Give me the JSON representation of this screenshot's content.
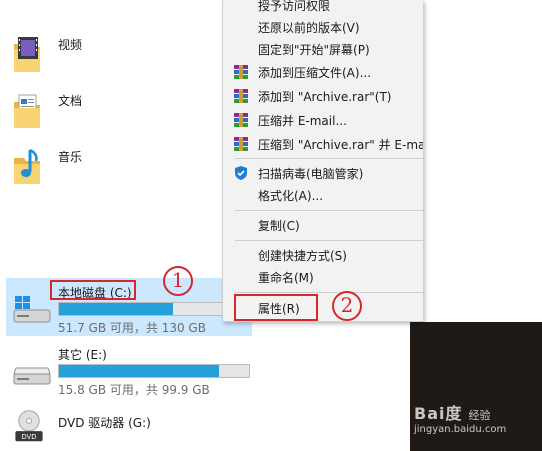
{
  "folders": [
    {
      "label": "视频",
      "icon": "video-folder-icon"
    },
    {
      "label": "文档",
      "icon": "documents-folder-icon"
    },
    {
      "label": "音乐",
      "icon": "music-folder-icon"
    }
  ],
  "drives": [
    {
      "name": "本地磁盘 (C:)",
      "info": "51.7 GB 可用，共 130 GB",
      "used_fraction": 0.6,
      "selected": true,
      "icon": "windows-drive-icon"
    },
    {
      "name": "其它 (E:)",
      "info": "15.8 GB 可用，共 99.9 GB",
      "used_fraction": 0.84,
      "selected": false,
      "icon": "hard-drive-icon"
    },
    {
      "name": "DVD 驱动器 (G:)",
      "icon": "dvd-drive-icon"
    }
  ],
  "context_menu": {
    "items": [
      {
        "label": "授予访问权限",
        "icon": ""
      },
      {
        "label": "还原以前的版本(V)",
        "icon": ""
      },
      {
        "label": "固定到\"开始\"屏幕(P)",
        "icon": ""
      },
      {
        "label": "添加到压缩文件(A)...",
        "icon": "winrar-icon"
      },
      {
        "label": "添加到 \"Archive.rar\"(T)",
        "icon": "winrar-icon"
      },
      {
        "label": "压缩并 E-mail...",
        "icon": "winrar-icon"
      },
      {
        "label": "压缩到 \"Archive.rar\" 并 E-mail",
        "icon": "winrar-icon"
      },
      {
        "label": "扫描病毒(电脑管家)",
        "icon": "shield-icon"
      },
      {
        "label": "格式化(A)...",
        "icon": ""
      },
      {
        "label": "复制(C)",
        "icon": ""
      },
      {
        "label": "创建快捷方式(S)",
        "icon": ""
      },
      {
        "label": "重命名(M)",
        "icon": ""
      },
      {
        "label": "属性(R)",
        "icon": ""
      }
    ]
  },
  "annotations": {
    "step1": "1",
    "step2": "2",
    "color": "#d9262c"
  },
  "colors": {
    "accent": "#26a0da",
    "selection": "#cce8ff",
    "menu_bg": "#f2f2f2"
  },
  "watermark": {
    "brand": "Bai度",
    "sub": "经验",
    "url": "jingyan.baidu.com"
  }
}
